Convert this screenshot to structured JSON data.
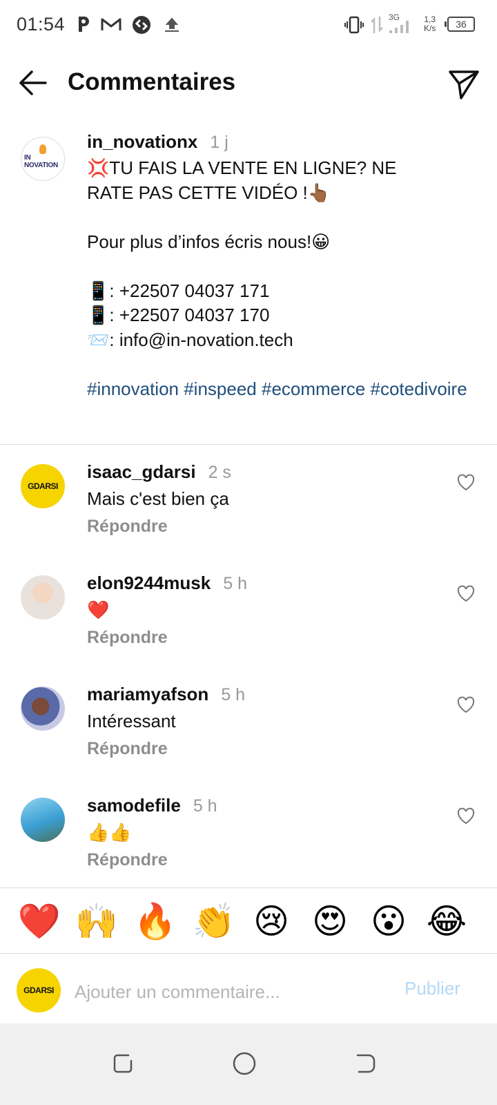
{
  "status_bar": {
    "time": "01:54",
    "network": "3G",
    "speed_value": "1,3",
    "speed_unit": "K/s",
    "battery": "36"
  },
  "header": {
    "title": "Commentaires"
  },
  "post": {
    "avatar_label": "IN NOVATION",
    "username": "in_novationx",
    "time": "1 j",
    "caption_lines": [
      "💢TU FAIS LA VENTE EN LIGNE? NE",
      "RATE PAS CETTE VIDÉO !👆🏾",
      "",
      "Pour plus d’infos écris nous!😀",
      "",
      "📱: +22507 04037 171",
      "📱: +22507 04037 170",
      "📨: info@in-novation.tech",
      ""
    ],
    "hashtags": "#innovation #inspeed #ecommerce #cotedivoire"
  },
  "comments": [
    {
      "username": "isaac_gdarsi",
      "time": "2 s",
      "text": "Mais c'est bien ça",
      "reply_label": "Répondre",
      "avatar_label": "GDARSI"
    },
    {
      "username": "elon9244musk",
      "time": "5 h",
      "text": "❤️",
      "reply_label": "Répondre"
    },
    {
      "username": "mariamyafson",
      "time": "5 h",
      "text": "Intéressant",
      "reply_label": "Répondre"
    },
    {
      "username": "samodefile",
      "time": "5 h",
      "text": "👍👍",
      "reply_label": "Répondre"
    }
  ],
  "emoji_bar": [
    "❤️",
    "🙌",
    "🔥",
    "👏",
    "😢",
    "😍",
    "😮",
    "😂"
  ],
  "input": {
    "avatar_label": "GDARSI",
    "placeholder": "Ajouter un commentaire...",
    "publish_label": "Publier"
  },
  "colors": {
    "hashtag": "#1f4e7a",
    "publish_disabled": "#b3d8f7",
    "secondary_text": "#8e8e8e",
    "gdarsi_yellow": "#f5d400"
  }
}
